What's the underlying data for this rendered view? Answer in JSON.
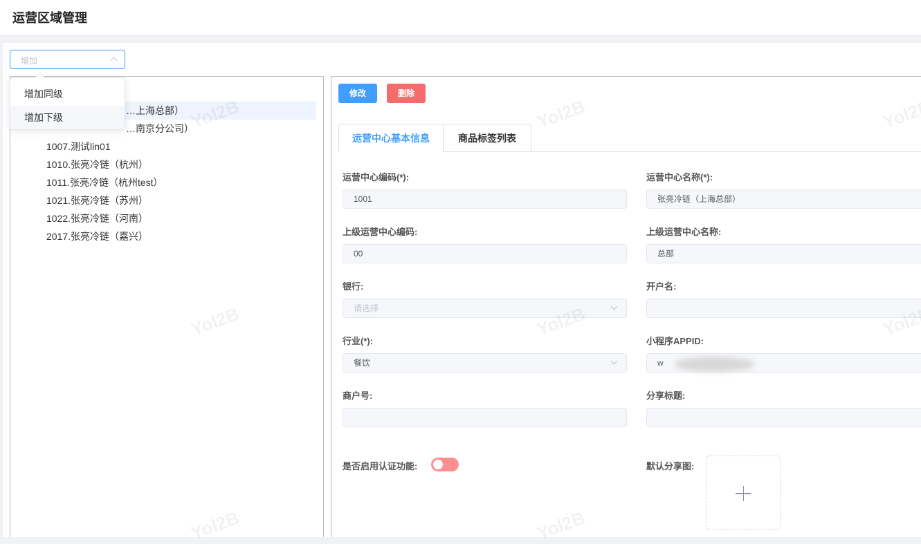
{
  "page": {
    "title": "运营区域管理",
    "watermark": "Yol2B"
  },
  "add_select": {
    "placeholder": "增加",
    "options": [
      "增加同级",
      "增加下级"
    ],
    "hovered": "增加下级"
  },
  "tree": {
    "nodes": [
      "…上海总部）",
      "…南京分公司）",
      "1007.测试lin01",
      "1010.张亮冷链（杭州）",
      "1011.张亮冷链（杭州test）",
      "1021.张亮冷链（苏州）",
      "1022.张亮冷链（河南）",
      "2017.张亮冷链（嘉兴）"
    ],
    "selected_index": 0
  },
  "toolbar": {
    "edit": "修改",
    "delete": "删除"
  },
  "tabs": [
    {
      "label": "运营中心基本信息",
      "active": true
    },
    {
      "label": "商品标签列表",
      "active": false
    }
  ],
  "form": {
    "code_label": "运营中心编码(*):",
    "code": "1001",
    "name_label": "运营中心名称(*):",
    "name": "张亮冷链（上海总部）",
    "parent_code_label": "上级运营中心编码:",
    "parent_code": "00",
    "parent_name_label": "上级运营中心名称:",
    "parent_name": "总部",
    "bank_label": "银行:",
    "bank_placeholder": "请选择",
    "account_name_label": "开户名:",
    "account_name": "",
    "industry_label": "行业(*):",
    "industry": "餐饮",
    "appid_label": "小程序APPID:",
    "appid": "w",
    "merchant_label": "商户号:",
    "merchant": "",
    "share_title_label": "分享标题:",
    "share_title": "",
    "auth_label": "是否启用认证功能:",
    "auth_enabled": false,
    "share_image_label": "默认分享图:"
  },
  "colors": {
    "primary": "#409eff",
    "danger": "#f56c6c",
    "switch_off": "#ff8f8f"
  }
}
